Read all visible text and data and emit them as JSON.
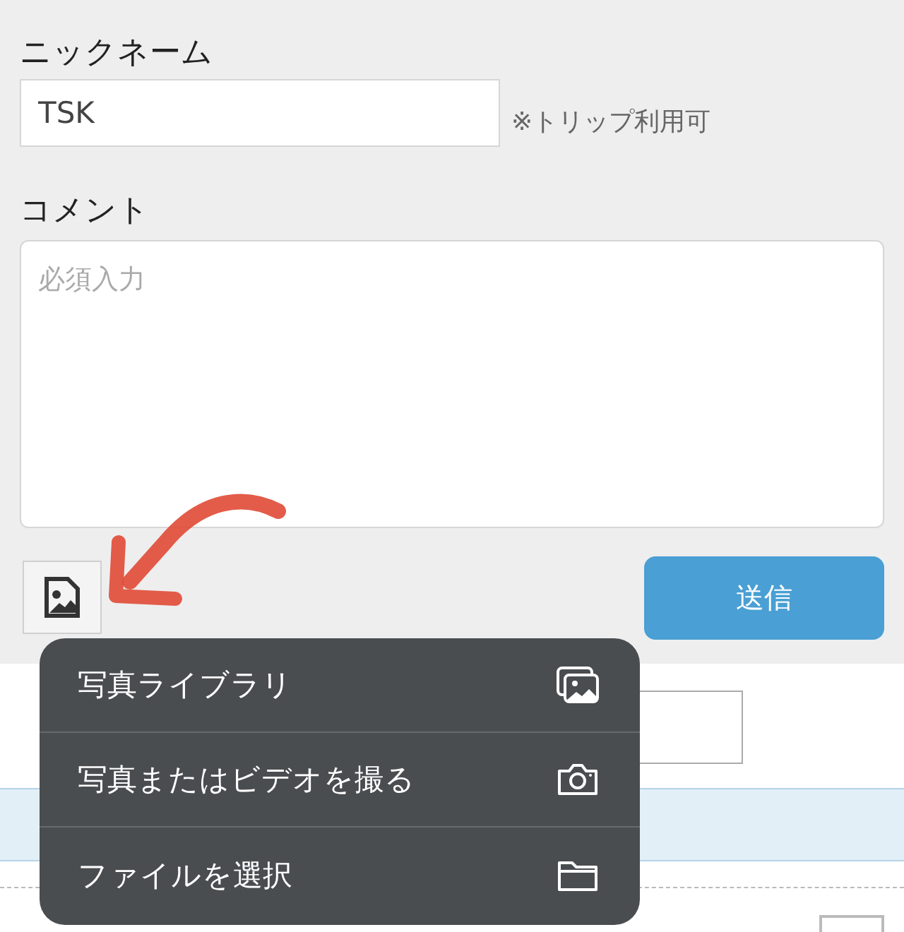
{
  "nickname": {
    "label": "ニックネーム",
    "value": "TSK",
    "note": "※トリップ利用可"
  },
  "comment": {
    "label": "コメント",
    "placeholder": "必須入力"
  },
  "submit": {
    "label": "送信"
  },
  "menu": [
    {
      "label": "写真ライブラリ",
      "kind": "library"
    },
    {
      "label": "写真またはビデオを撮る",
      "kind": "camera"
    },
    {
      "label": "ファイルを選択",
      "kind": "folder"
    }
  ]
}
